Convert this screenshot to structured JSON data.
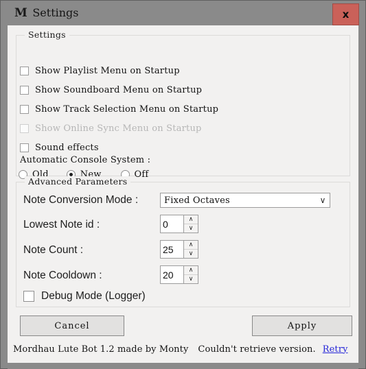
{
  "window": {
    "logo": "M",
    "title": "Settings",
    "close_label": "x",
    "close_color": "#ca6159",
    "titlebar_color": "#8a8a8a",
    "client_color": "#f2f1f0"
  },
  "settings_group": {
    "title": "Settings",
    "checkboxes": [
      {
        "label": "Show Playlist Menu on Startup",
        "checked": false,
        "disabled": false
      },
      {
        "label": "Show Soundboard Menu on Startup",
        "checked": false,
        "disabled": false
      },
      {
        "label": "Show Track Selection Menu on Startup",
        "checked": false,
        "disabled": false
      },
      {
        "label": "Show Online Sync Menu on Startup",
        "checked": false,
        "disabled": true
      },
      {
        "label": "Sound effects",
        "checked": false,
        "disabled": false
      }
    ],
    "console_system": {
      "label": "Automatic Console System :",
      "options": [
        {
          "label": "Old",
          "selected": false
        },
        {
          "label": "New",
          "selected": true
        },
        {
          "label": "Off",
          "selected": false
        }
      ]
    }
  },
  "advanced_group": {
    "title": "Advanced Parameters",
    "note_conversion_mode": {
      "label": "Note Conversion Mode :",
      "value": "Fixed Octaves",
      "arrow": "∨"
    },
    "lowest_note_id": {
      "label": "Lowest Note id :",
      "value": "0",
      "up": "∧",
      "down": "∨"
    },
    "note_count": {
      "label": "Note Count :",
      "value": "25",
      "up": "∧",
      "down": "∨"
    },
    "note_cooldown": {
      "label": "Note Cooldown :",
      "value": "20",
      "up": "∧",
      "down": "∨"
    },
    "debug_mode": {
      "label": "Debug Mode (Logger)",
      "checked": false
    }
  },
  "buttons": {
    "cancel": "Cancel",
    "apply": "Apply"
  },
  "statusbar": {
    "app_info": "Mordhau Lute Bot 1.2 made by Monty",
    "version_message": "Couldn't retrieve version.",
    "retry_link": "Retry",
    "link_color": "#2727d8"
  }
}
